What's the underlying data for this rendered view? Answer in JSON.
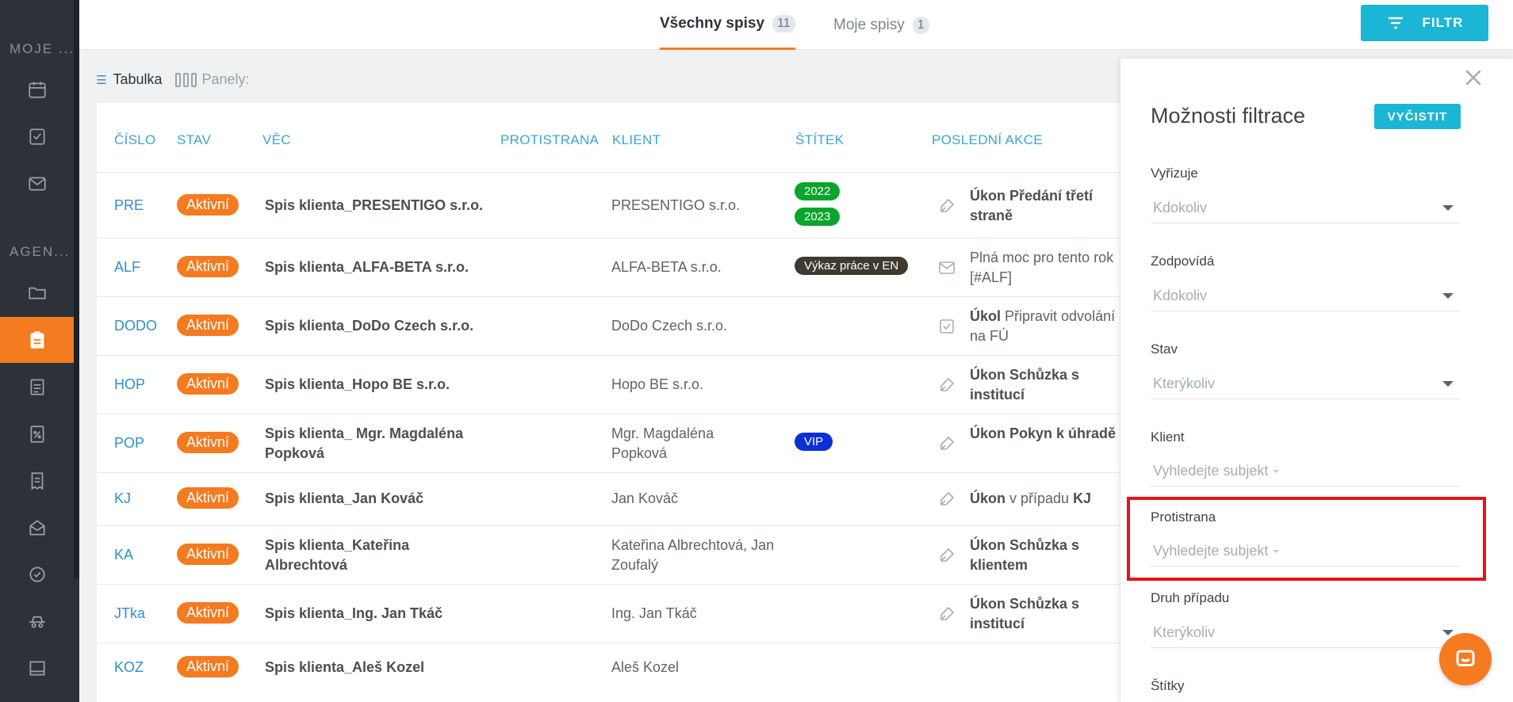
{
  "sidebar": {
    "section1": "MOJE ...",
    "section2": "AGEN..."
  },
  "tabs": [
    {
      "label": "Všechny spisy",
      "count": "11"
    },
    {
      "label": "Moje spisy",
      "count": "1"
    }
  ],
  "filter_button": "FILTR",
  "view": {
    "table": "Tabulka",
    "panels": "Panely:"
  },
  "columns": [
    "ČÍSLO",
    "STAV",
    "VĚC",
    "PROTISTRANA",
    "KLIENT",
    "ŠTÍTEK",
    "POSLEDNÍ AKCE"
  ],
  "rows": [
    {
      "cislo": "PRE",
      "stav": "Aktivní",
      "vec": "Spis klienta_PRESENTIGO s.r.o.",
      "klient": "PRESENTIGO s.r.o.",
      "tags": [
        "2022",
        "2023"
      ],
      "akce_bold": "Úkon Předání třetí straně",
      "akce_rest": ""
    },
    {
      "cislo": "ALF",
      "stav": "Aktivní",
      "vec": "Spis klienta_ALFA-BETA s.r.o.",
      "klient": "ALFA-BETA s.r.o.",
      "tags": [
        "Výkaz práce v EN"
      ],
      "akce_bold": "",
      "akce_rest": "Plná moc pro tento rok [#ALF]"
    },
    {
      "cislo": "DODO",
      "stav": "Aktivní",
      "vec": "Spis klienta_DoDo Czech s.r.o.",
      "klient": "DoDo Czech s.r.o.",
      "tags": [],
      "akce_bold": "Úkol",
      "akce_rest": " Připravit odvolání na FÚ"
    },
    {
      "cislo": "HOP",
      "stav": "Aktivní",
      "vec": "Spis klienta_Hopo BE s.r.o.",
      "klient": "Hopo BE s.r.o.",
      "tags": [],
      "akce_bold": "Úkon Schůzka s institucí",
      "akce_rest": ""
    },
    {
      "cislo": "POP",
      "stav": "Aktivní",
      "vec": "Spis klienta_ Mgr. Magdaléna Popková",
      "klient": "Mgr. Magdaléna Popková",
      "tags": [
        "VIP"
      ],
      "akce_bold": "Úkon Pokyn k úhradě",
      "akce_rest": ""
    },
    {
      "cislo": "KJ",
      "stav": "Aktivní",
      "vec": "Spis klienta_Jan Kováč",
      "klient": "Jan Kováč",
      "tags": [],
      "akce_bold": "Úkon",
      "akce_rest": " v případu ",
      "akce_tail": "KJ"
    },
    {
      "cislo": "KA",
      "stav": "Aktivní",
      "vec": "Spis klienta_Kateřina Albrechtová",
      "klient": "Kateřina Albrechtová, Jan Zoufalý",
      "tags": [],
      "akce_bold": "Úkon Schůzka s klientem",
      "akce_rest": ""
    },
    {
      "cislo": "JTka",
      "stav": "Aktivní",
      "vec": "Spis klienta_Ing. Jan Tkáč",
      "klient": "Ing. Jan Tkáč",
      "tags": [],
      "akce_bold": "Úkon Schůzka s institucí",
      "akce_rest": ""
    },
    {
      "cislo": "KOZ",
      "stav": "Aktivní",
      "vec": "Spis klienta_Aleš Kozel",
      "klient": "Aleš Kozel",
      "tags": [],
      "akce_bold": "",
      "akce_rest": ""
    }
  ],
  "tag_colors": {
    "2022": "#0aa52c",
    "2023": "#0aa52c",
    "Výkaz práce v EN": "#3f3a2f",
    "VIP": "#0d2fd6"
  },
  "accent_color": "#f47b20",
  "panel": {
    "title": "Možnosti filtrace",
    "clear": "VYČISTIT",
    "fields": [
      {
        "label": "Vyřizuje",
        "value": "Kdokoliv"
      },
      {
        "label": "Zodpovídá",
        "value": "Kdokoliv"
      },
      {
        "label": "Stav",
        "value": "Kterýkoliv"
      },
      {
        "label": "Klient",
        "value": "Vyhledejte subjekt"
      },
      {
        "label": "Protistrana",
        "value": "Vyhledejte subjekt"
      },
      {
        "label": "Druh případu",
        "value": "Kterýkoliv"
      },
      {
        "label": "Štítky",
        "value": ""
      }
    ]
  }
}
